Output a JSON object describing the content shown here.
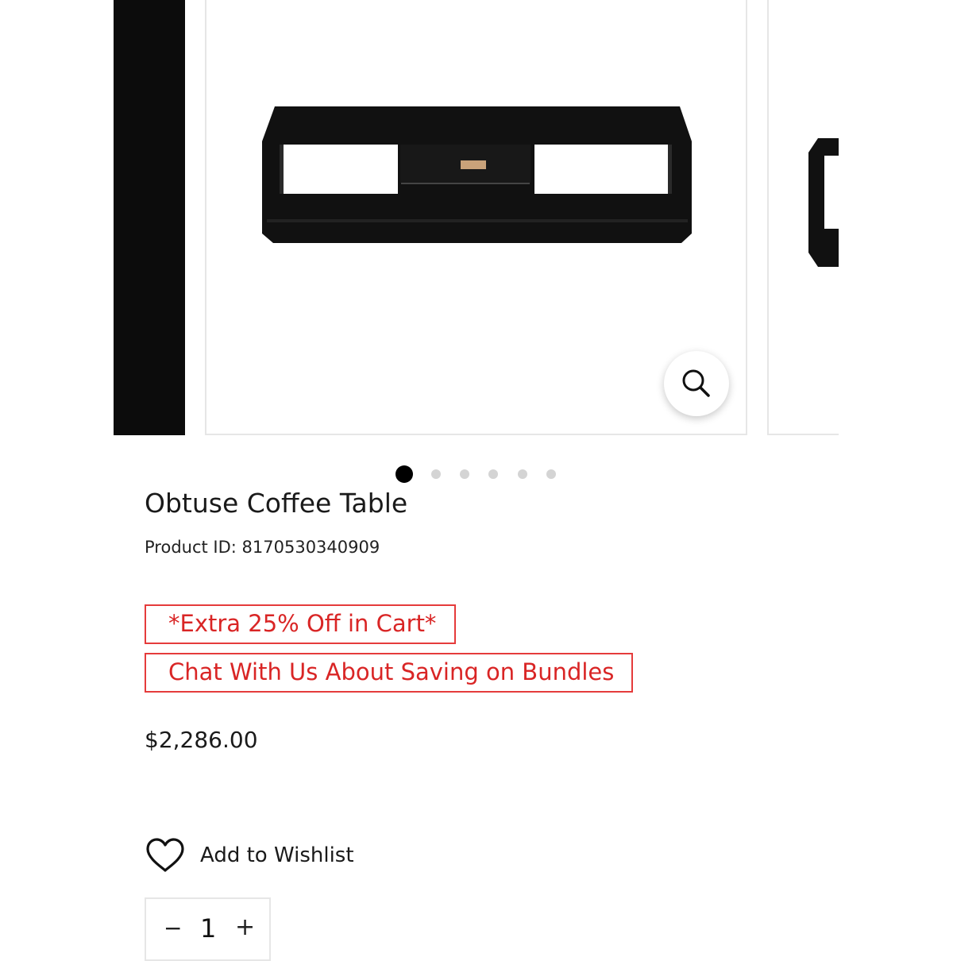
{
  "gallery": {
    "active_slide": 1,
    "slide_count": 6,
    "zoom_icon": "magnifier-icon"
  },
  "product": {
    "title": "Obtuse Coffee Table",
    "id_text": "Product ID: 8170530340909",
    "promos": [
      "*Extra 25% Off in Cart*",
      "Chat With Us About Saving on Bundles"
    ],
    "price": "$2,286.00"
  },
  "wishlist": {
    "icon": "heart-icon",
    "label": "Add to Wishlist"
  },
  "quantity": {
    "minus": "−",
    "value": "1",
    "plus": "+"
  },
  "colors": {
    "promo_red": "#d92525",
    "dot_active": "#000000",
    "dot_inactive": "#d4d4d4"
  }
}
